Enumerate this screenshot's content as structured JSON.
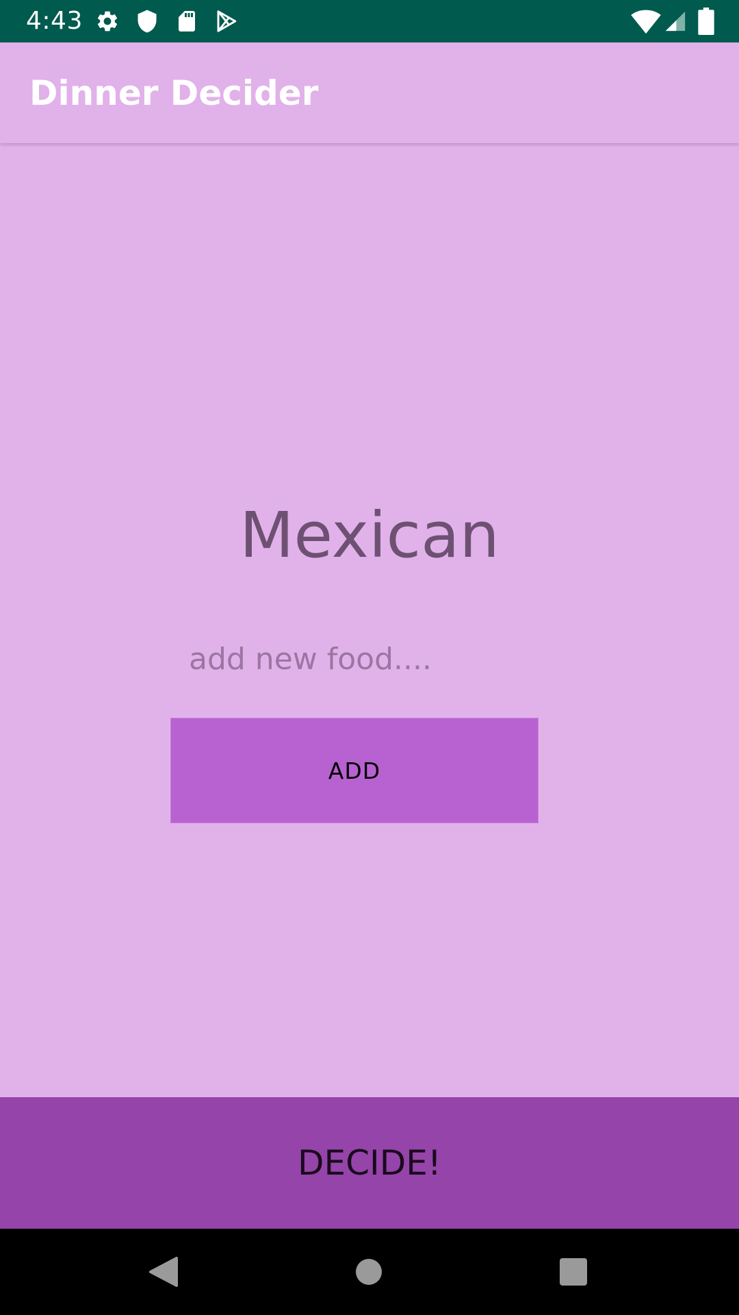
{
  "status_bar": {
    "time": "4:43",
    "left_icons": [
      "gear-icon",
      "shield-icon",
      "sd-card-icon",
      "play-store-icon"
    ],
    "right_icons": [
      "wifi-icon",
      "cell-signal-icon",
      "battery-icon"
    ]
  },
  "app_bar": {
    "title": "Dinner Decider"
  },
  "main": {
    "selected_food": "Mexican",
    "new_food_input": {
      "value": "",
      "placeholder": "add new food...."
    },
    "add_label": "ADD"
  },
  "decide_label": "DECIDE!",
  "nav_bar": {
    "icons": [
      "back-icon",
      "home-icon",
      "recents-icon"
    ]
  },
  "colors": {
    "status_bar": "#005a4e",
    "background": "#e1b2ea",
    "add_button": "#b862d2",
    "decide_button": "#9544a9",
    "food_text": "#6e5073"
  }
}
